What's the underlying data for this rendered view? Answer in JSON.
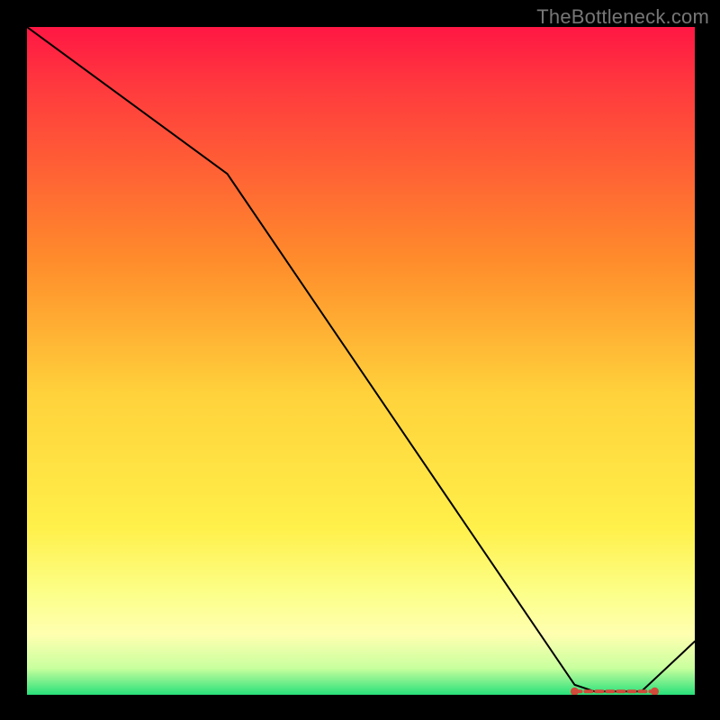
{
  "watermark": "TheBottleneck.com",
  "chart_data": {
    "type": "line",
    "title": "",
    "xlabel": "",
    "ylabel": "",
    "xlim": [
      0,
      100
    ],
    "ylim": [
      0,
      100
    ],
    "x": [
      0,
      30,
      82,
      85,
      92,
      100
    ],
    "values": [
      100,
      78,
      1.5,
      0.5,
      0.5,
      8
    ],
    "optimal_band": {
      "x_start": 82,
      "x_end": 94,
      "y": 0.5
    },
    "background_gradient": {
      "stops": [
        {
          "pct": 0,
          "color": "#ff1744"
        },
        {
          "pct": 10,
          "color": "#ff3d3d"
        },
        {
          "pct": 35,
          "color": "#ff8c2b"
        },
        {
          "pct": 55,
          "color": "#ffd23b"
        },
        {
          "pct": 75,
          "color": "#fff04a"
        },
        {
          "pct": 85,
          "color": "#fcff8a"
        },
        {
          "pct": 91,
          "color": "#ffffb0"
        },
        {
          "pct": 96,
          "color": "#c9ff9e"
        },
        {
          "pct": 100,
          "color": "#28e07a"
        }
      ]
    }
  }
}
